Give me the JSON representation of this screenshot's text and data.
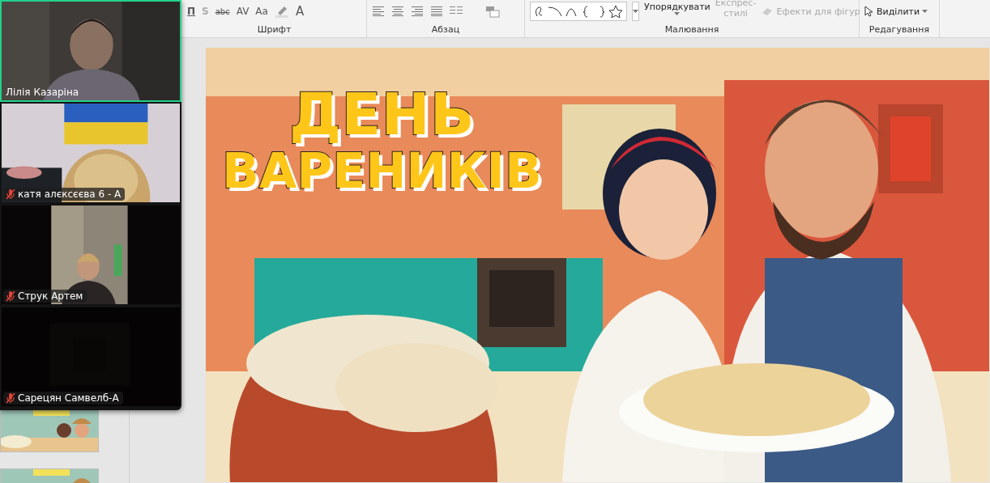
{
  "ribbon": {
    "font_tools": [
      {
        "text": "П",
        "kind": "underline",
        "disabled": false
      },
      {
        "text": "S",
        "kind": "shadow",
        "disabled": true
      },
      {
        "text": "abc",
        "kind": "strike",
        "disabled": false
      },
      {
        "text": "AV",
        "kind": "spacing",
        "disabled": false
      },
      {
        "text": "Aa",
        "kind": "case",
        "disabled": false
      }
    ],
    "font_color_tool": {
      "text": "A"
    },
    "groups": [
      {
        "label": "Шрифт"
      },
      {
        "label": "Абзац"
      },
      {
        "label": "Малювання"
      },
      {
        "label": "Редагування"
      }
    ],
    "arrange": {
      "label": "Упорядкувати"
    },
    "quick_styles": {
      "label_lines": [
        "Експрес-",
        "стилі"
      ],
      "disabled": true
    },
    "shape_effects": {
      "label": "Ефекти для фігур",
      "disabled": true
    },
    "select": {
      "label": "Виділити"
    }
  },
  "participants": [
    {
      "name": "Лілія Казаріна",
      "muted": false,
      "speaking": true
    },
    {
      "name": "катя алєксєєва 6 - А",
      "muted": true,
      "speaking": false
    },
    {
      "name": "Струк Артем",
      "muted": true,
      "speaking": false
    },
    {
      "name": "Сарецян Самвелб-А",
      "muted": true,
      "speaking": false
    }
  ],
  "slide": {
    "title_lines": [
      "ДЕНЬ",
      "ВАРЕНИКІВ"
    ]
  }
}
